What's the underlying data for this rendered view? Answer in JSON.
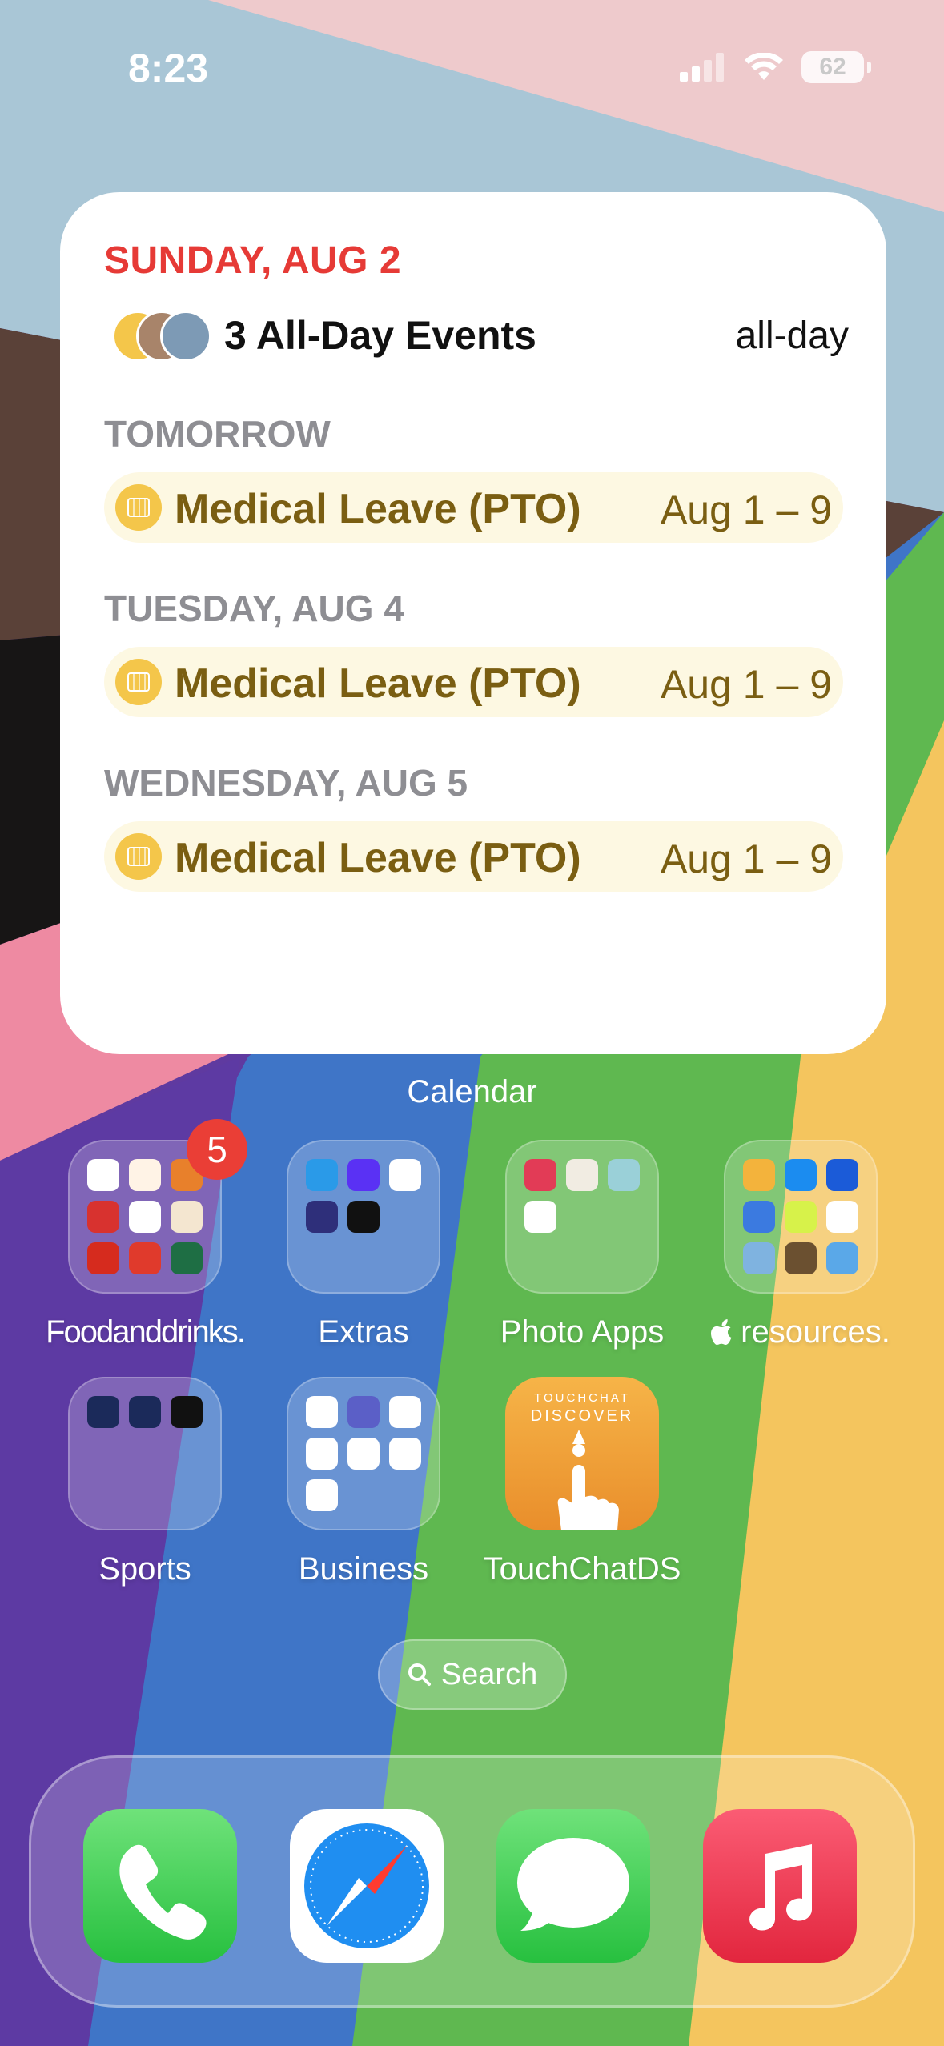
{
  "status_bar": {
    "time": "8:23",
    "battery": "62"
  },
  "widget": {
    "date_heading": "SUNDAY, AUG 2",
    "all_day": {
      "title": "3 All-Day Events",
      "time": "all-day"
    },
    "sections": [
      {
        "label": "TOMORROW",
        "event": {
          "name": "Medical Leave (PTO)",
          "range": "Aug 1 – 9"
        }
      },
      {
        "label": "TUESDAY, AUG 4",
        "event": {
          "name": "Medical Leave (PTO)",
          "range": "Aug 1 – 9"
        }
      },
      {
        "label": "WEDNESDAY, AUG 5",
        "event": {
          "name": "Medical Leave (PTO)",
          "range": "Aug 1 – 9"
        }
      }
    ],
    "caption": "Calendar"
  },
  "apps": [
    {
      "label": "Foodanddrinks.",
      "badge": "5"
    },
    {
      "label": "Extras"
    },
    {
      "label": "Photo Apps"
    },
    {
      "label": " resources."
    },
    {
      "label": "Sports"
    },
    {
      "label": "Business"
    },
    {
      "label": "TouchChatDS",
      "icon_text_top": "TOUCHCHAT",
      "icon_text_bottom": "DISCOVER"
    }
  ],
  "search": {
    "label": "Search"
  },
  "dock": [
    "phone-icon",
    "safari-icon",
    "messages-icon",
    "music-icon"
  ],
  "colors": {
    "calendar_red": "#e63a36",
    "event_text": "#7a5e12",
    "event_bg": "#fdf8e2"
  }
}
